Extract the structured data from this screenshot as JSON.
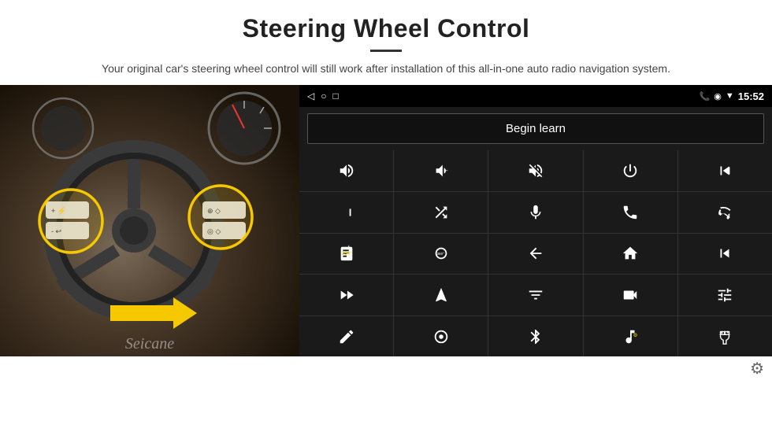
{
  "header": {
    "title": "Steering Wheel Control",
    "subtitle": "Your original car's steering wheel control will still work after installation of this all-in-one auto radio navigation system."
  },
  "statusBar": {
    "time": "15:52",
    "navIcons": [
      "◁",
      "○",
      "□"
    ],
    "rightIcons": [
      "📞",
      "⊕",
      "▼"
    ]
  },
  "beginLearnBtn": "Begin learn",
  "controlGrid": [
    {
      "icon": "vol+",
      "unicode": "🔊+"
    },
    {
      "icon": "vol-",
      "unicode": "🔉-"
    },
    {
      "icon": "mute",
      "unicode": "🔇"
    },
    {
      "icon": "power",
      "unicode": "⏻"
    },
    {
      "icon": "prev-track",
      "unicode": "⏮"
    },
    {
      "icon": "next-track",
      "unicode": "⏭"
    },
    {
      "icon": "shuffle",
      "unicode": "⇌"
    },
    {
      "icon": "mic",
      "unicode": "🎤"
    },
    {
      "icon": "phone",
      "unicode": "📞"
    },
    {
      "icon": "hang-up",
      "unicode": "📵"
    },
    {
      "icon": "camera",
      "unicode": "📷"
    },
    {
      "icon": "360view",
      "unicode": "🔄"
    },
    {
      "icon": "back",
      "unicode": "↩"
    },
    {
      "icon": "home",
      "unicode": "⌂"
    },
    {
      "icon": "skip-back",
      "unicode": "⏮"
    },
    {
      "icon": "fast-forward",
      "unicode": "⏩"
    },
    {
      "icon": "navigation",
      "unicode": "➤"
    },
    {
      "icon": "eq",
      "unicode": "⇌"
    },
    {
      "icon": "record",
      "unicode": "📷"
    },
    {
      "icon": "settings2",
      "unicode": "⚙"
    },
    {
      "icon": "pen",
      "unicode": "✏"
    },
    {
      "icon": "circle-dot",
      "unicode": "◎"
    },
    {
      "icon": "bluetooth",
      "unicode": "⚡"
    },
    {
      "icon": "music",
      "unicode": "♪"
    },
    {
      "icon": "bars",
      "unicode": "≡"
    }
  ],
  "seicane": "Seicane",
  "settingsGear": "⚙"
}
